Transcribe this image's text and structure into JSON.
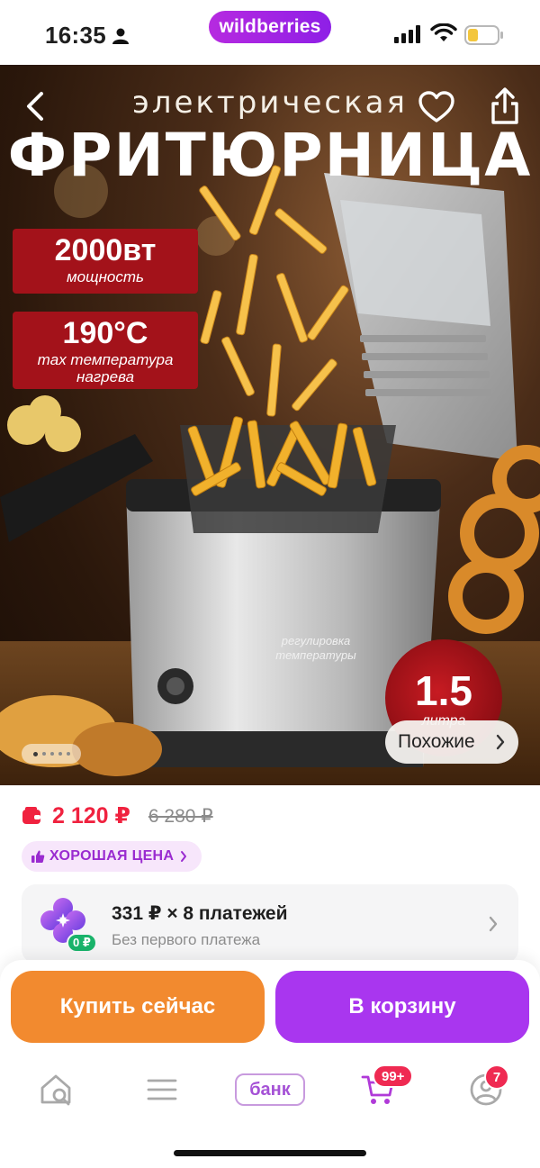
{
  "status_bar": {
    "time": "16:35",
    "brand": "wildberries"
  },
  "hero": {
    "title_small": "электрическая",
    "title_big": "ФРИТЮРНИЦА",
    "specs": [
      {
        "value": "2000вт",
        "label": "мощность"
      },
      {
        "value": "190°C",
        "label": "max температура нагрева"
      }
    ],
    "temp_note": "регулировка температуры",
    "volume_value": "1.5",
    "volume_label": "литра",
    "similar_label": "Похожие"
  },
  "price": {
    "current": "2 120 ₽",
    "old": "6 280 ₽",
    "good_price_label": "ХОРОШАЯ ЦЕНА"
  },
  "installment": {
    "title": "331 ₽ × 8 платежей",
    "subtitle": "Без первого платежа",
    "zero_badge": "0 ₽"
  },
  "actions": {
    "buy_now": "Купить сейчас",
    "add_to_cart": "В корзину"
  },
  "tab_bar": {
    "bank_label": "банк",
    "cart_badge": "99+",
    "profile_badge": "7"
  },
  "colors": {
    "brand": "#a936ef",
    "buy_now": "#f28a2f",
    "price": "#f0223f",
    "badge": "#ef2a52"
  }
}
